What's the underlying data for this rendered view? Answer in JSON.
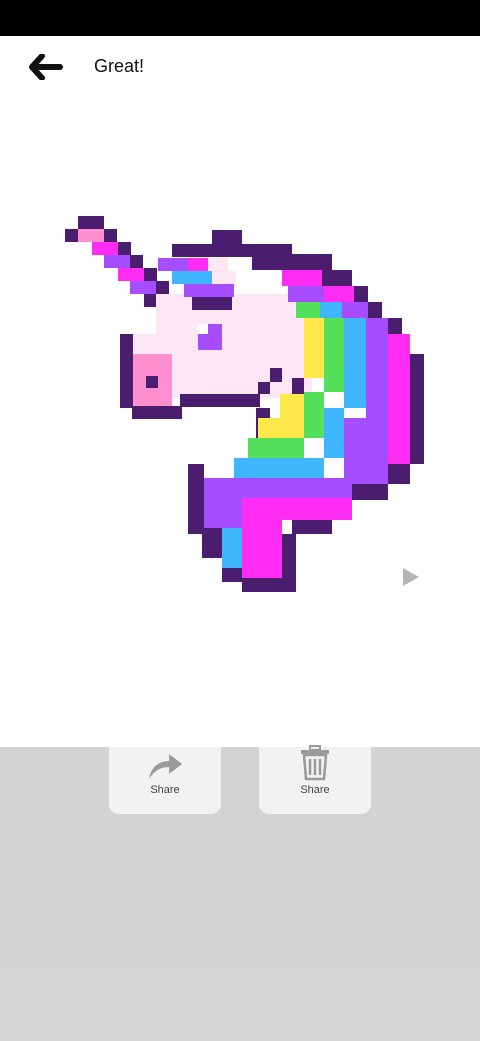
{
  "header": {
    "title": "Great!",
    "back_icon": "arrow-left-icon"
  },
  "artwork": {
    "subject": "pixel-art unicorn",
    "play_icon": "play-icon"
  },
  "actions": [
    {
      "label": "Share",
      "icon": "share-arrow-icon"
    },
    {
      "label": "Share",
      "icon": "trash-icon"
    }
  ],
  "colors": {
    "outline": "#4b1d6e",
    "magenta": "#ff2df3",
    "purple": "#a64dff",
    "blue": "#3fb6ff",
    "green": "#54e05a",
    "yellow": "#ffe94a",
    "pink_face": "#ffe6f5",
    "nose": "#ff8fcf"
  }
}
